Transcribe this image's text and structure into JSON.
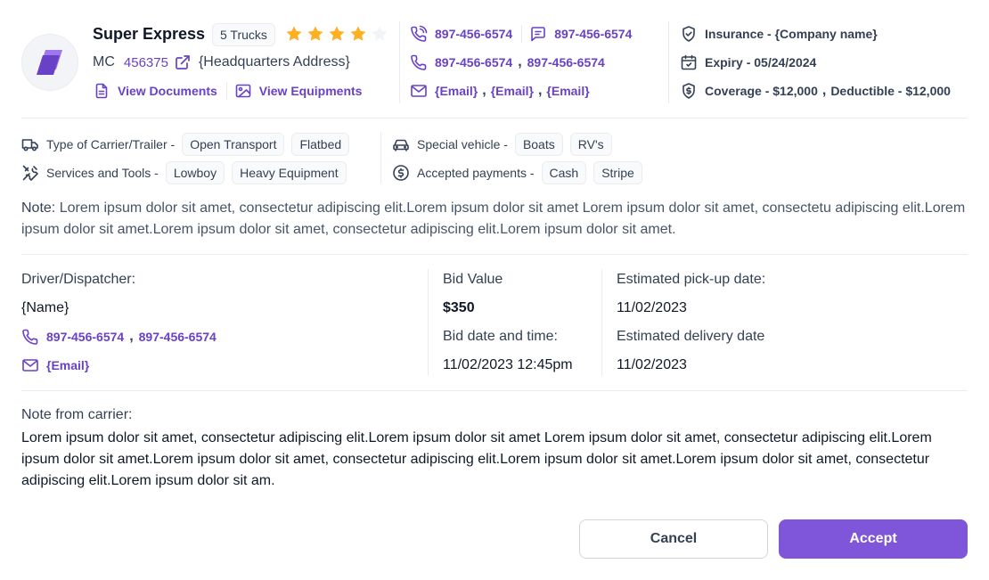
{
  "carrier": {
    "name": "Super Express",
    "trucks": "5 Trucks",
    "rating": 4,
    "rating_max": 5,
    "mc_label": "MC",
    "mc_number": "456375",
    "address": "{Headquarters Address}",
    "view_documents": "View Documents",
    "view_equipments": "View Equipments"
  },
  "contact": {
    "phone_1": "897-456-6574",
    "sms_1": "897-456-6574",
    "phone_2a": "897-456-6574",
    "phone_2b": "897-456-6574",
    "email_1": "{Email}",
    "email_2": "{Email}",
    "email_3": "{Email}",
    "separator": ","
  },
  "insurance": {
    "insurance": "Insurance - {Company name}",
    "expiry": "Expiry - 05/24/2024",
    "coverage": "Coverage - $12,000",
    "deductible": "Deductible  - $12,000"
  },
  "tags": {
    "carrier_type_label": "Type of Carrier/Trailer -",
    "carrier_types": [
      "Open Transport",
      "Flatbed"
    ],
    "services_label": "Services and Tools -",
    "services": [
      "Lowboy",
      "Heavy Equipment"
    ],
    "special_label": "Special vehicle -",
    "special": [
      "Boats",
      "RV's"
    ],
    "payments_label": "Accepted payments -",
    "payments": [
      "Cash",
      "Stripe"
    ]
  },
  "note": {
    "label": "Note:",
    "text": " Lorem ipsum dolor sit amet, consectetur adipiscing elit.Lorem ipsum dolor sit amet Lorem ipsum dolor sit amet, consectetu adipiscing elit.Lorem ipsum dolor sit amet.Lorem ipsum dolor sit amet, consectetur adipiscing elit.Lorem ipsum dolor sit amet."
  },
  "details": {
    "driver_label": "Driver/Dispatcher:",
    "driver_name": "{Name}",
    "driver_phone_1": "897-456-6574",
    "driver_phone_2": "897-456-6574",
    "driver_email": "{Email}",
    "bid_value_label": "Bid Value",
    "bid_value": "$350",
    "bid_date_label": "Bid date and time:",
    "bid_date": "11/02/2023 12:45pm",
    "pickup_label": "Estimated pick-up date:",
    "pickup_date": "11/02/2023",
    "delivery_label": "Estimated delivery date",
    "delivery_date": "11/02/2023"
  },
  "carrier_note": {
    "label": "Note from carrier:",
    "text": "Lorem ipsum dolor sit amet, consectetur adipiscing elit.Lorem ipsum dolor sit amet Lorem ipsum dolor sit amet, consectetur adipiscing elit.Lorem ipsum dolor sit amet.Lorem ipsum dolor sit amet, consectetur adipiscing elit.Lorem ipsum dolor sit amet.Lorem ipsum dolor sit amet, consectetur adipiscing elit.Lorem ipsum dolor sit am."
  },
  "actions": {
    "cancel": "Cancel",
    "accept": "Accept"
  },
  "colors": {
    "accent": "#7f56d9",
    "link": "#6941c6",
    "star_filled": "#fdb022",
    "star_empty": "#f2f4f7"
  }
}
